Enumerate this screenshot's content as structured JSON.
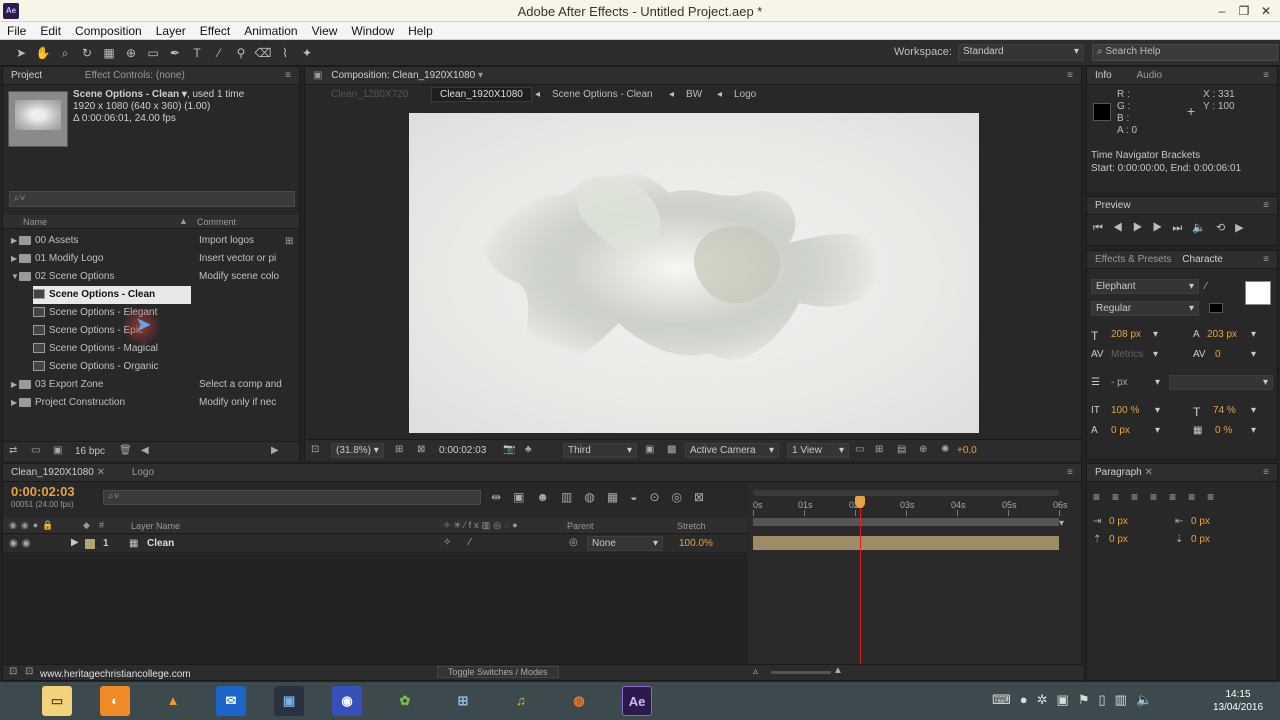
{
  "title_bar": {
    "app_icon": "Ae",
    "title": "Adobe After Effects - Untitled Project.aep *"
  },
  "menu": [
    "File",
    "Edit",
    "Composition",
    "Layer",
    "Effect",
    "Animation",
    "View",
    "Window",
    "Help"
  ],
  "toolbar": {
    "workspace_label": "Workspace:",
    "workspace_value": "Standard",
    "search_placeholder": "Search Help"
  },
  "project_panel": {
    "tabs": [
      "Project",
      "Effect Controls: (none)"
    ],
    "selected_item": {
      "name": "Scene Options - Clean ▾",
      "used": ", used 1 time",
      "size": "1920 x 1080  (640 x 360) (1.00)",
      "duration": "Δ 0:00:06:01, 24.00 fps"
    },
    "search_placeholder": "⌕˅",
    "columns": {
      "name": "Name",
      "comment": "Comment"
    },
    "items": [
      {
        "name": "00 Assets",
        "comment": "Import logos",
        "type": "folder",
        "indent": 0
      },
      {
        "name": "01 Modify Logo",
        "comment": "Insert vector or pi",
        "type": "folder",
        "indent": 0
      },
      {
        "name": "02 Scene Options",
        "comment": "Modify scene colo",
        "type": "folder",
        "indent": 0,
        "open": true
      },
      {
        "name": "Scene Options - Clean",
        "comment": "",
        "type": "comp",
        "indent": 1,
        "selected": true
      },
      {
        "name": "Scene Options - Elegant",
        "comment": "",
        "type": "comp",
        "indent": 1
      },
      {
        "name": "Scene Options - Epic",
        "comment": "",
        "type": "comp",
        "indent": 1
      },
      {
        "name": "Scene Options - Magical",
        "comment": "",
        "type": "comp",
        "indent": 1
      },
      {
        "name": "Scene Options - Organic",
        "comment": "",
        "type": "comp",
        "indent": 1
      },
      {
        "name": "03 Export Zone",
        "comment": "Select a comp and",
        "type": "folder",
        "indent": 0
      },
      {
        "name": "Project Construction",
        "comment": "Modify only if nec",
        "type": "folder",
        "indent": 0
      }
    ],
    "bpc": "16 bpc"
  },
  "comp_panel": {
    "tab": "Composition: Clean_1920X1080",
    "breadcrumbs": [
      "Clean_1280X720",
      "Clean_1920X1080",
      "Scene Options - Clean",
      "BW",
      "Logo"
    ],
    "zoom": "(31.8%)",
    "timecode": "0:00:02:03",
    "resolution": "Third",
    "camera": "Active Camera",
    "view": "1 View",
    "exposure": "+0.0"
  },
  "info_panel": {
    "tabs": [
      "Info",
      "Audio"
    ],
    "r": "R :",
    "g": "G :",
    "b": "B :",
    "a": "A : 0",
    "x": "X : 331",
    "y": "Y : 100",
    "nav_title": "Time Navigator Brackets",
    "nav_range": "Start: 0:00:00:00, End: 0:00:06:01"
  },
  "preview_panel": {
    "tab": "Preview"
  },
  "character_panel": {
    "tabs": [
      "Effects & Presets",
      "Characte"
    ],
    "font": "Elephant",
    "style": "Regular",
    "size": "208 px",
    "leading": "203 px",
    "kerning": "Metrics",
    "tracking": "0",
    "stroke": "- px",
    "vscale": "100 %",
    "hscale": "74 %",
    "baseline": "0 px",
    "tsume": "0 %"
  },
  "paragraph_panel": {
    "tab": "Paragraph",
    "indent_left": "0 px",
    "indent_right": "0 px",
    "space_before": "0 px",
    "space_after": "0 px"
  },
  "timeline": {
    "tabs": [
      "Clean_1920X1080",
      "Logo"
    ],
    "timecode": "0:00:02:03",
    "frame_info": "00051 (24.00 fps)",
    "columns": {
      "layer_name": "Layer Name",
      "parent": "Parent",
      "stretch": "Stretch",
      "num": "#"
    },
    "layers": [
      {
        "num": "1",
        "name": "Clean",
        "parent": "None",
        "stretch": "100.0%"
      }
    ],
    "ruler": [
      "0s",
      "01s",
      "02s",
      "03s",
      "04s",
      "05s",
      "06s"
    ],
    "toggle_label": "Toggle Switches / Modes",
    "playhead_fraction": 0.35
  },
  "watermark": "www.heritagechristiancollege.com",
  "taskbar": {
    "time": "14:15",
    "date": "13/04/2016"
  }
}
